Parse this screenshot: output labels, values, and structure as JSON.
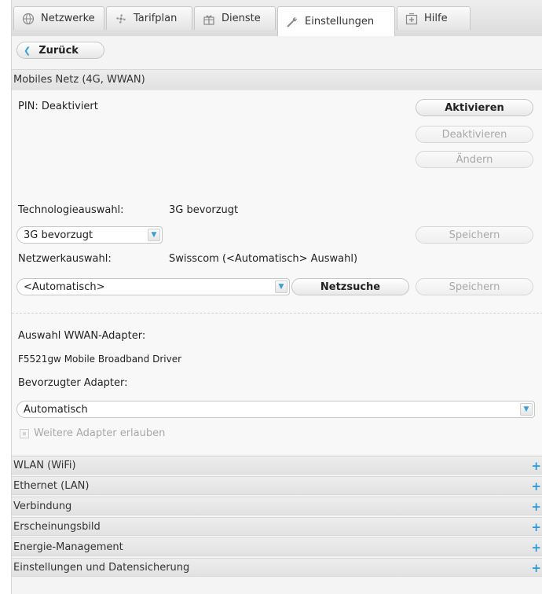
{
  "tabs": [
    {
      "label": "Netzwerke",
      "icon": "globe-icon"
    },
    {
      "label": "Tarifplan",
      "icon": "fan-icon"
    },
    {
      "label": "Dienste",
      "icon": "gift-icon"
    },
    {
      "label": "Einstellungen",
      "icon": "wrench-icon",
      "active": true
    },
    {
      "label": "Hilfe",
      "icon": "help-icon"
    }
  ],
  "back_label": "Zurück",
  "mobile": {
    "header": "Mobiles Netz (4G, WWAN)",
    "pin_status": "PIN: Deaktiviert",
    "activate_label": "Aktivieren",
    "deactivate_label": "Deaktivieren",
    "change_label": "Ändern",
    "tech_label": "Technologieauswahl:",
    "tech_value": "3G bevorzugt",
    "tech_select": "3G bevorzugt",
    "save_label": "Speichern",
    "network_label": "Netzwerkauswahl:",
    "network_value": "Swisscom (<Automatisch> Auswahl)",
    "network_select": "<Automatisch>",
    "network_search_label": "Netzsuche",
    "save2_label": "Speichern",
    "adapter_heading": "Auswahl WWAN-Adapter:",
    "adapter_name": "F5521gw Mobile Broadband Driver",
    "preferred_label": "Bevorzugter Adapter:",
    "preferred_select": "Automatisch",
    "allow_more_label": "Weitere Adapter erlauben"
  },
  "sections": [
    {
      "label": "WLAN (WiFi)"
    },
    {
      "label": "Ethernet (LAN)"
    },
    {
      "label": "Verbindung"
    },
    {
      "label": "Erscheinungsbild"
    },
    {
      "label": "Energie-Management"
    },
    {
      "label": "Einstellungen und Datensicherung"
    }
  ],
  "expand_symbol": "+",
  "colors": {
    "accent": "#2a9ad6",
    "disabled_text": "#a8a8a8"
  }
}
